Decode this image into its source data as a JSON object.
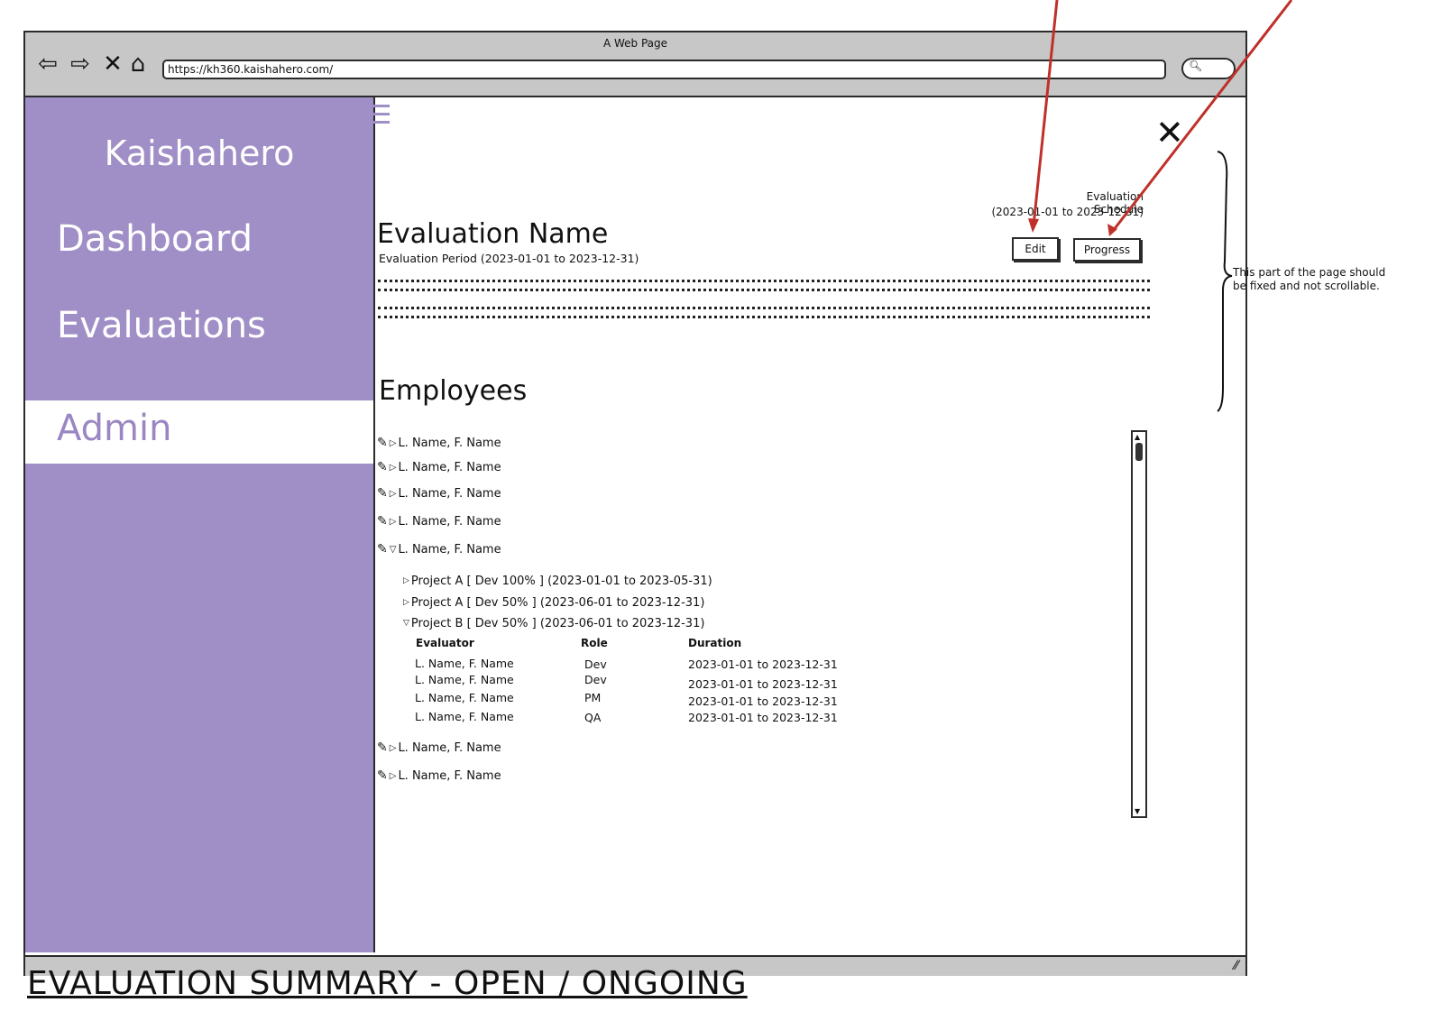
{
  "window": {
    "title": "A Web Page",
    "url": "https://kh360.kaishahero.com/"
  },
  "sidebar": {
    "brand": "Kaishahero",
    "items": [
      {
        "label": "Dashboard",
        "active": false
      },
      {
        "label": "Evaluations",
        "active": false
      },
      {
        "label": "Admin",
        "active": true
      }
    ]
  },
  "schedule": {
    "label": "Evaluation Schedule",
    "range": "(2023-01-01 to 2023-12-31)"
  },
  "actions": {
    "edit_label": "Edit",
    "progress_label": "Progress"
  },
  "evaluation": {
    "name": "Evaluation Name",
    "period": "Evaluation Period (2023-01-01 to 2023-12-31)"
  },
  "employees": {
    "heading": "Employees",
    "rows_before": [
      "L. Name, F. Name",
      "L. Name, F. Name",
      "L. Name, F. Name",
      "L. Name, F. Name"
    ],
    "expanded_row": "L. Name, F. Name",
    "projects": [
      {
        "label": "Project A [ Dev 100% ] (2023-01-01 to 2023-05-31)",
        "expanded": false
      },
      {
        "label": "Project A [ Dev 50% ] (2023-06-01 to 2023-12-31)",
        "expanded": false
      },
      {
        "label": "Project B [ Dev 50% ] (2023-06-01 to 2023-12-31)",
        "expanded": true
      }
    ],
    "evaluator_table": {
      "headers": [
        "Evaluator",
        "Role",
        "Duration"
      ],
      "rows": [
        [
          "L. Name, F. Name",
          "Dev",
          "2023-01-01 to 2023-12-31"
        ],
        [
          "L. Name, F. Name",
          "Dev",
          "2023-01-01 to 2023-12-31"
        ],
        [
          "L. Name, F. Name",
          "PM",
          "2023-01-01 to 2023-12-31"
        ],
        [
          "L. Name, F. Name",
          "QA",
          "2023-01-01 to 2023-12-31"
        ]
      ]
    },
    "rows_after": [
      "L. Name, F. Name",
      "L. Name, F. Name"
    ]
  },
  "annotation": {
    "note": "This part of the page should be fixed and not scrollable."
  },
  "caption": "EVALUATION SUMMARY - OPEN / ONGOING",
  "colors": {
    "sidebar": "#a08ec6",
    "annotation_arrow": "#c0302a"
  }
}
